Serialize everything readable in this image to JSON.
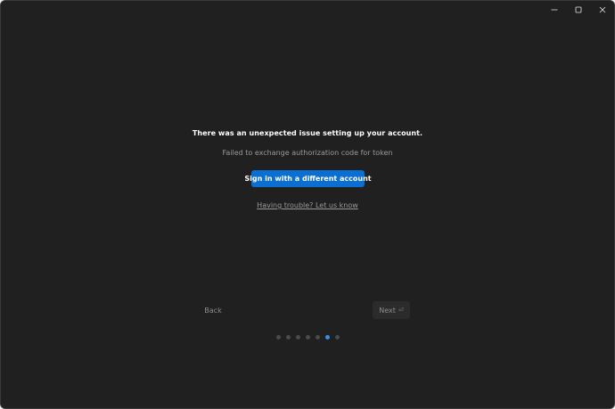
{
  "window": {
    "controls": {
      "minimize": "minimize-icon",
      "maximize": "maximize-icon",
      "close": "close-icon"
    }
  },
  "error": {
    "title": "There was an unexpected issue setting up your account.",
    "detail": "Failed to exchange authorization code for token"
  },
  "actions": {
    "signin_label": "Sign in with a different account",
    "trouble_link": "Having trouble? Let us know"
  },
  "navigation": {
    "back_label": "Back",
    "next_label": "Next",
    "next_icon": "enter-icon"
  },
  "progress": {
    "total_steps": 7,
    "current_step": 6
  },
  "colors": {
    "background": "#202020",
    "accent": "#0a6fd1",
    "active_dot": "#3b8de0"
  }
}
